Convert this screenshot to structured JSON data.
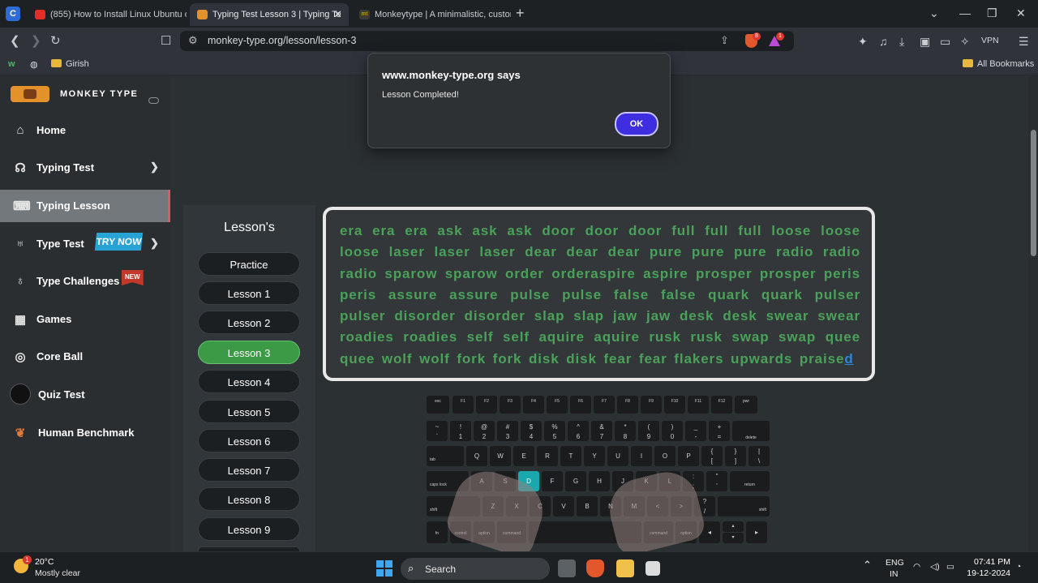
{
  "browser": {
    "tabs": [
      {
        "title": "(855) How to Install Linux Ubuntu o",
        "favicon": "youtube-icon"
      },
      {
        "title": "Typing Test Lesson 3 | Typing Te",
        "favicon": "monkey-icon"
      },
      {
        "title": "Monkeytype | A minimalistic, custom",
        "favicon": "monkeytype-icon"
      }
    ],
    "url": "monkey-type.org/lesson/lesson-3",
    "bookmarks": {
      "left_folder": "Girish",
      "right_folder": "All Bookmarks"
    },
    "badges": {
      "brave_shield": "8",
      "rewards": "1"
    },
    "vpn_label": "VPN"
  },
  "sidebar": {
    "brand": "MONKEY TYPE",
    "items": [
      {
        "label": "Home",
        "icon": "home-icon"
      },
      {
        "label": "Typing Test",
        "icon": "github-icon"
      },
      {
        "label": "Typing Lesson",
        "icon": "keyboard-icon"
      },
      {
        "label": "Type Test",
        "icon": "gitlab-icon"
      },
      {
        "label": "Type Challenges",
        "icon": "award-icon"
      },
      {
        "label": "Games",
        "icon": "grid-icon"
      },
      {
        "label": "Core Ball",
        "icon": "target-icon"
      },
      {
        "label": "Quiz Test",
        "icon": "avatar"
      },
      {
        "label": "Human Benchmark",
        "icon": "brain-icon"
      }
    ],
    "try_now": "TRY NOW",
    "new_badge": "NEW"
  },
  "lessons": {
    "title": "Lesson's",
    "items": [
      "Practice",
      "Lesson 1",
      "Lesson 2",
      "Lesson 3",
      "Lesson 4",
      "Lesson 5",
      "Lesson 6",
      "Lesson 7",
      "Lesson 8",
      "Lesson 9"
    ],
    "active_index": 3
  },
  "typing": {
    "text": "era era era ask ask ask door door door full full full loose loose loose laser laser laser dear dear dear pure pure pure radio radio radio sparow sparow order orderaspire aspire prosper prosper peris peris assure assure pulse pulse false false quark quark pulser pulser disorder disorder slap slap jaw jaw desk desk swear swear roadies roadies self self aquire aquire rusk rusk swap swap quee quee wolf wolf fork fork disk disk fear fear flakers upwards praise",
    "cursor_char": "d",
    "highlighted_key": "D"
  },
  "dialog": {
    "title": "www.monkey-type.org says",
    "message": "Lesson Completed!",
    "ok_label": "OK"
  },
  "taskbar": {
    "temperature": "20°C",
    "condition": "Mostly clear",
    "weather_badge": "1",
    "search_placeholder": "Search",
    "language": "ENG",
    "region": "IN",
    "time": "07:41 PM",
    "date": "19-12-2024"
  },
  "colors": {
    "accent_green": "#4aa15a",
    "ok_button": "#3f2ee0",
    "active_nav_border": "#e0566e"
  }
}
